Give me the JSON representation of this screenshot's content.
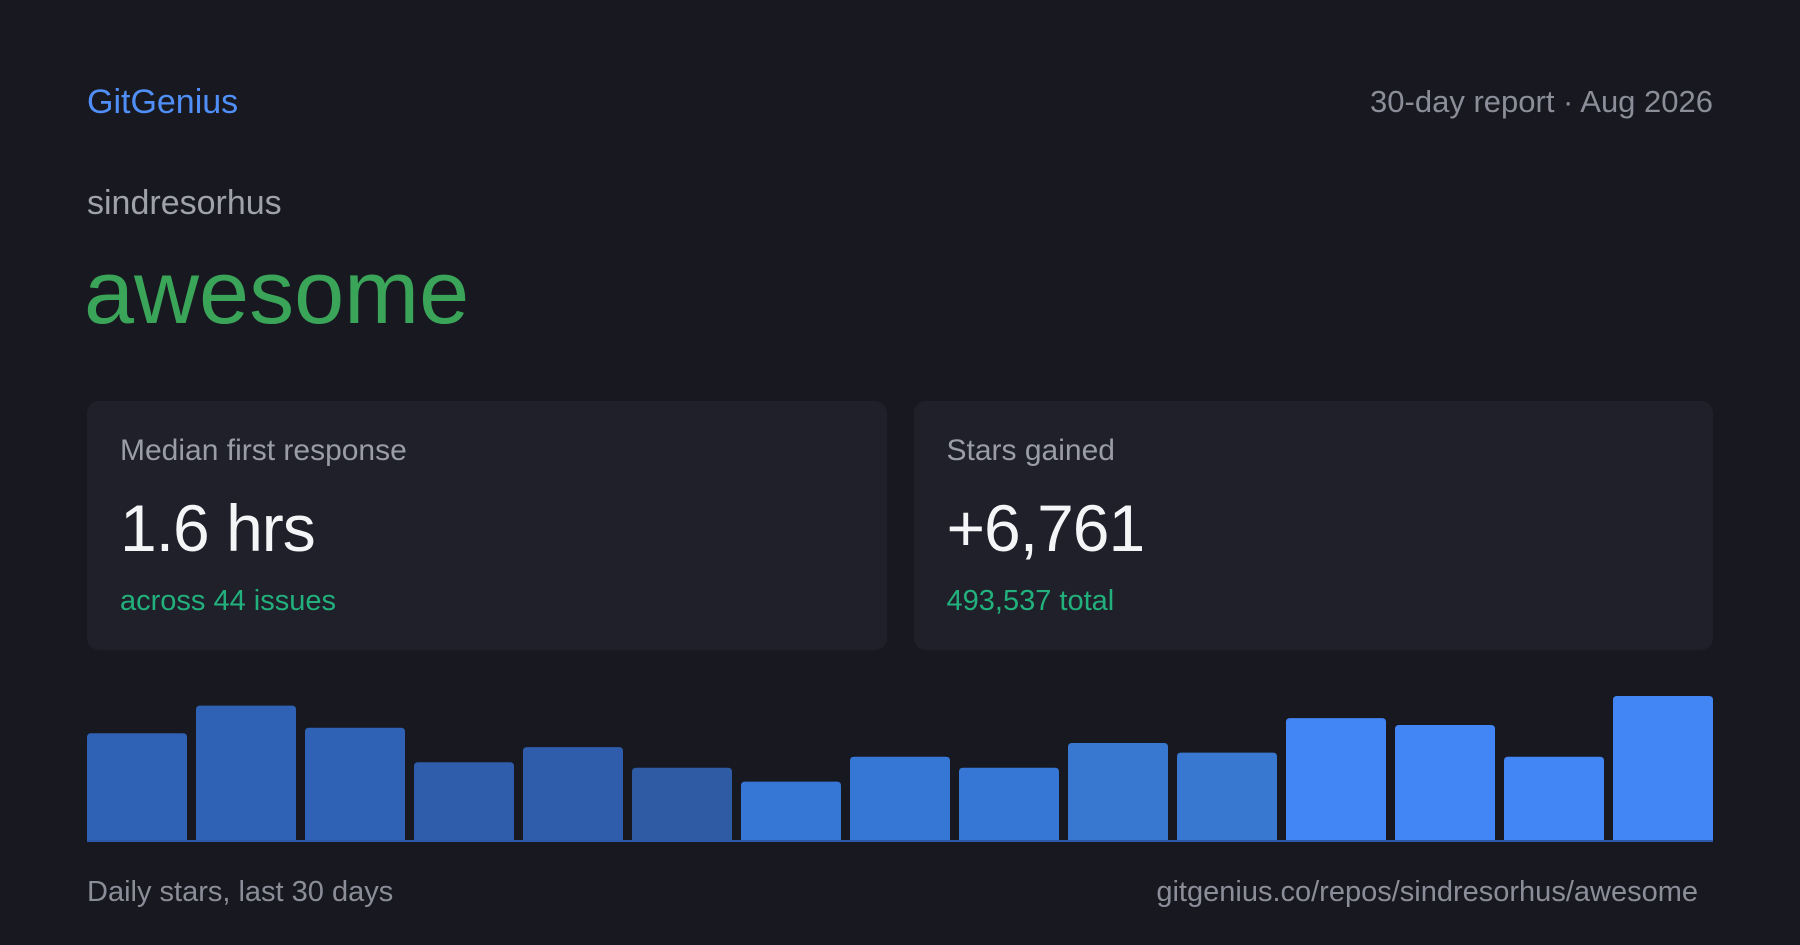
{
  "header": {
    "brand": "GitGenius",
    "report": "30-day report · Aug 2026"
  },
  "repo": {
    "owner": "sindresorhus",
    "name": "awesome"
  },
  "cards": [
    {
      "label": "Median first response",
      "value": "1.6 hrs",
      "sub": "across 44 issues"
    },
    {
      "label": "Stars gained",
      "value": "+6,761",
      "sub": "493,537 total"
    }
  ],
  "colors": {
    "background": "#171820",
    "brand": "#4f8ff7",
    "repo_name": "#3aa458",
    "card_bg": "#1f2029",
    "positive": "#22b07d",
    "axis": "#2b5aa8"
  },
  "chart_data": {
    "type": "bar",
    "values": [
      78,
      98,
      82,
      57,
      68,
      53,
      43,
      61,
      53,
      71,
      64,
      89,
      84,
      61,
      105
    ],
    "colors": [
      "#2f62b4",
      "#2f62b4",
      "#2f62b4",
      "#2f5dab",
      "#2f5dab",
      "#2f5aa4",
      "#3676d4",
      "#3676d4",
      "#3676d4",
      "#3878d0",
      "#3878d0",
      "#4285f4",
      "#4285f4",
      "#4285f4",
      "#4285f4"
    ],
    "ylim": [
      0,
      105
    ],
    "caption": "Daily stars, last 30 days"
  },
  "footer": {
    "caption": "Daily stars, last 30 days",
    "url": "gitgenius.co/repos/sindresorhus/awesome"
  }
}
